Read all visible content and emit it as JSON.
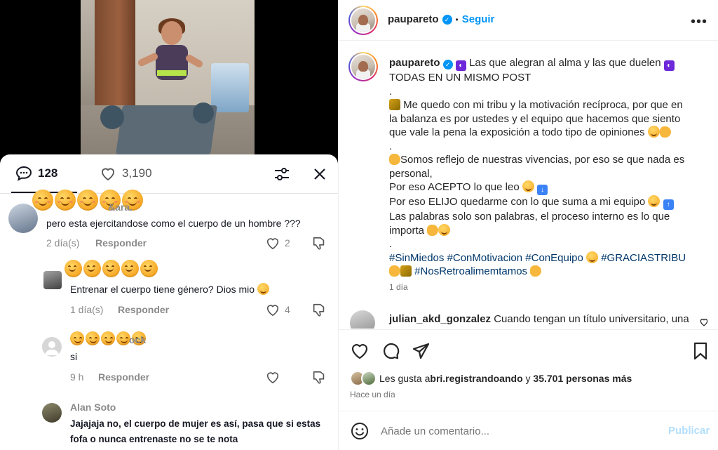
{
  "left_panel": {
    "comment_count": "128",
    "like_count": "3,190",
    "comments": [
      {
        "username": "Milla ... & ... ara.",
        "text": "pero esta ejercitandose como el cuerpo de un hombre ???",
        "time": "2 día(s)",
        "reply_label": "Responder",
        "likes": "2"
      },
      {
        "username": "",
        "text": "Entrenar el cuerpo tiene género? Dios mio",
        "time": "1 día(s)",
        "reply_label": "Responder",
        "likes": "4"
      },
      {
        "username": "...ock",
        "text": "si",
        "time": "9 h",
        "reply_label": "Responder",
        "likes": ""
      },
      {
        "username": "Alan Soto",
        "text_line1": "Jajajaja no, el cuerpo de mujer es así, pasa que si estas",
        "text_line2": "fofa o nunca entrenaste no se te nota"
      }
    ]
  },
  "post": {
    "username": "paupareto",
    "dot": "•",
    "follow_label": "Seguir",
    "more_label": "•••",
    "caption": {
      "line1": "Las que alegran al alma y las que duelen",
      "line2": "TODAS EN UN MISMO POST",
      "line3": ".",
      "line4": "Me quedo con mi tribu y la motivación recíproca, por que en",
      "line5": "la balanza es por ustedes y el equipo que hacemos que siento",
      "line6": "que vale la pena la exposición a todo tipo de opiniones",
      "line7": ".",
      "line8": "Somos reflejo de nuestras vivencias, por eso se que nada es",
      "line9": "personal,",
      "line10": "Por eso ACEPTO lo que leo",
      "line11": "Por eso ELIJO quedarme con lo que suma a mi equipo",
      "line12": "Las palabras solo son palabras, el proceso interno es lo que",
      "line13": "importa",
      "line14": ".",
      "hashtags1": "#SinMiedos #ConMotivacion #ConEquipo",
      "hashtags1b": "#GRACIASTRIBU",
      "hashtags2": "#NosRetroalimemtamos"
    },
    "caption_time": "1 día",
    "comment": {
      "username": "julian_akd_gonzalez",
      "text": "Cuando tengan un título universitario, una"
    },
    "likes_prefix": "Les gusta a ",
    "likes_user": "bri.registrandoando",
    "likes_mid": " y ",
    "likes_count": "35.701 personas más",
    "date": "Hace un día",
    "comment_placeholder": "Añade un comentario...",
    "publish_label": "Publicar"
  }
}
